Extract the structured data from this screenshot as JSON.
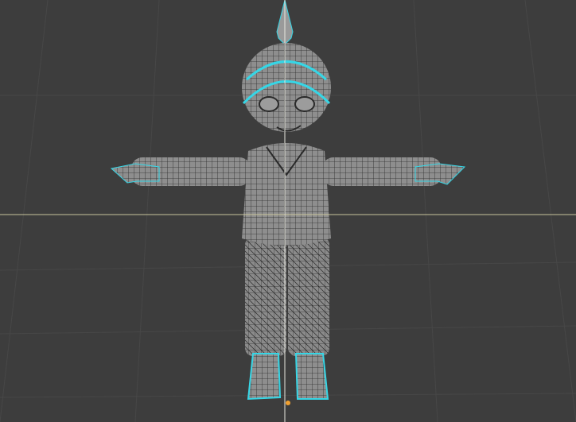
{
  "viewport": {
    "background_color": "#3d3d3d",
    "mesh_color": "#8e8e8e",
    "wire_color": "#2a2a2a",
    "selection_color": "#36d6e6",
    "x_axis_color": "#c8c49a",
    "z_axis_color": "#e8e8e0"
  }
}
